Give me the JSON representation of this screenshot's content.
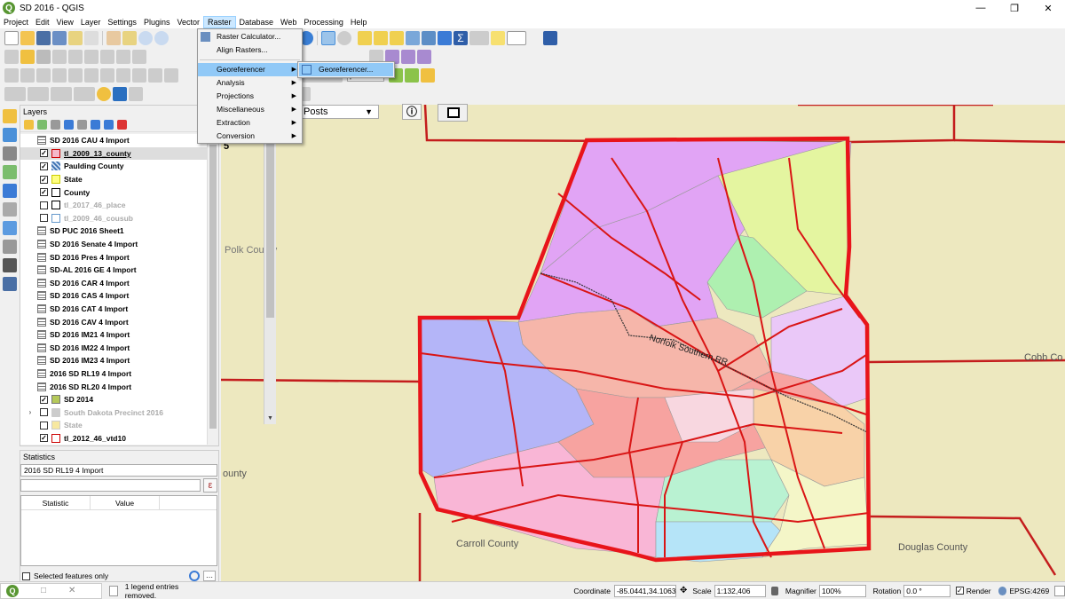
{
  "window": {
    "title": "SD 2016 - QGIS",
    "minimize": "—",
    "maximize": "❐",
    "close": "✕"
  },
  "menus": [
    "Project",
    "Edit",
    "View",
    "Layer",
    "Settings",
    "Plugins",
    "Vector",
    "Raster",
    "Database",
    "Web",
    "Processing",
    "Help"
  ],
  "raster_menu": {
    "items": [
      "Raster Calculator...",
      "Align Rasters...",
      "Georeferencer",
      "Analysis",
      "Projections",
      "Miscellaneous",
      "Extraction",
      "Conversion"
    ],
    "submenu_item": "Georeferencer..."
  },
  "toolbar": {
    "units": "px"
  },
  "layers_panel": {
    "title": "Layers",
    "layers": [
      {
        "label": "SD 2016 CAU 4 Import",
        "type": "table",
        "checked": null
      },
      {
        "label": "tl_2009_13_county",
        "type": "poly",
        "color": "#f5b8c8",
        "stroke": "#c00",
        "checked": true,
        "selected": true
      },
      {
        "label": "Paulding County",
        "type": "raster",
        "checked": true
      },
      {
        "label": "State",
        "type": "poly",
        "color": "#ffff80",
        "stroke": "#cc0",
        "checked": true
      },
      {
        "label": "County",
        "type": "poly",
        "color": "#fff",
        "stroke": "#000",
        "checked": true
      },
      {
        "label": "tl_2017_46_place",
        "type": "poly",
        "color": "#fff",
        "stroke": "#000",
        "checked": false,
        "dim": true
      },
      {
        "label": "tl_2009_46_cousub",
        "type": "poly",
        "color": "#fff",
        "stroke": "#69c",
        "checked": false,
        "dim": true
      },
      {
        "label": "SD PUC 2016 Sheet1",
        "type": "table",
        "checked": null
      },
      {
        "label": "SD 2016 Senate 4 Import",
        "type": "table",
        "checked": null
      },
      {
        "label": "SD 2016 Pres 4 Import",
        "type": "table",
        "checked": null
      },
      {
        "label": "SD-AL 2016 GE 4 Import",
        "type": "table",
        "checked": null
      },
      {
        "label": "SD 2016 CAR 4 Import",
        "type": "table",
        "checked": null
      },
      {
        "label": "SD 2016 CAS 4 Import",
        "type": "table",
        "checked": null
      },
      {
        "label": "SD 2016 CAT 4 Import",
        "type": "table",
        "checked": null
      },
      {
        "label": "SD 2016 CAV 4 Import",
        "type": "table",
        "checked": null
      },
      {
        "label": "SD 2016 IM21 4 Import",
        "type": "table",
        "checked": null
      },
      {
        "label": "SD 2016 IM22 4 Import",
        "type": "table",
        "checked": null
      },
      {
        "label": "SD 2016 IM23 4 Import",
        "type": "table",
        "checked": null
      },
      {
        "label": "2016 SD RL19 4 Import",
        "type": "table",
        "checked": null
      },
      {
        "label": "2016 SD RL20 4 Import",
        "type": "table",
        "checked": null
      },
      {
        "label": "SD 2014",
        "type": "poly",
        "color": "#b5c95a",
        "stroke": "#777",
        "checked": true
      },
      {
        "label": "South Dakota Precinct 2016",
        "type": "group",
        "checked": false,
        "dim": true,
        "expander": "›"
      },
      {
        "label": "State",
        "type": "poly",
        "color": "#f7e8a0",
        "stroke": "#ccc",
        "checked": false,
        "dim": true
      },
      {
        "label": "tl_2012_46_vtd10",
        "type": "poly",
        "color": "#fff",
        "stroke": "#c00",
        "checked": true
      }
    ]
  },
  "stats_panel": {
    "title": "Statistics",
    "layer": "2016 SD RL19 4 Import",
    "col_statistic": "Statistic",
    "col_value": "Value",
    "selected_only": "Selected features only"
  },
  "map": {
    "posts_label": "Posts",
    "num_label": "5",
    "county_labels": [
      "Polk County",
      "Carroll County",
      "Douglas County",
      "Cobb Co",
      "ounty"
    ],
    "railroad_label": "Norfolk Southern RR"
  },
  "statusbar": {
    "message": "1 legend entries removed.",
    "coordinate_label": "Coordinate",
    "coordinate": "-85.0441,34.1063",
    "scale_label": "Scale",
    "scale": "1:132,406",
    "magnifier_label": "Magnifier",
    "magnifier": "100%",
    "rotation_label": "Rotation",
    "rotation": "0.0 °",
    "render_label": "Render",
    "crs": "EPSG:4269"
  }
}
